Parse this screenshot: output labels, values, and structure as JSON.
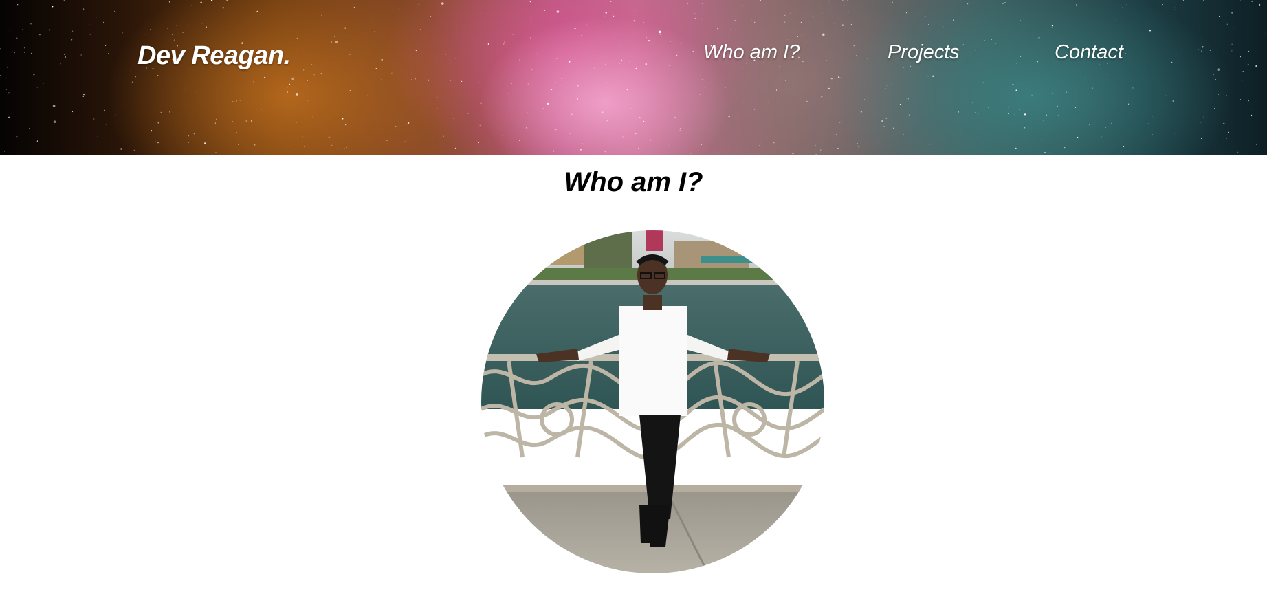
{
  "header": {
    "logo": "Dev Reagan.",
    "nav": [
      {
        "label": "Who am I?"
      },
      {
        "label": "Projects"
      },
      {
        "label": "Contact"
      }
    ]
  },
  "main": {
    "section_title": "Who am I?",
    "profile_photo": "profile-photo"
  },
  "colors": {
    "nav_text": "#ffffff",
    "title_text": "#000000",
    "page_background": "#ffffff"
  }
}
